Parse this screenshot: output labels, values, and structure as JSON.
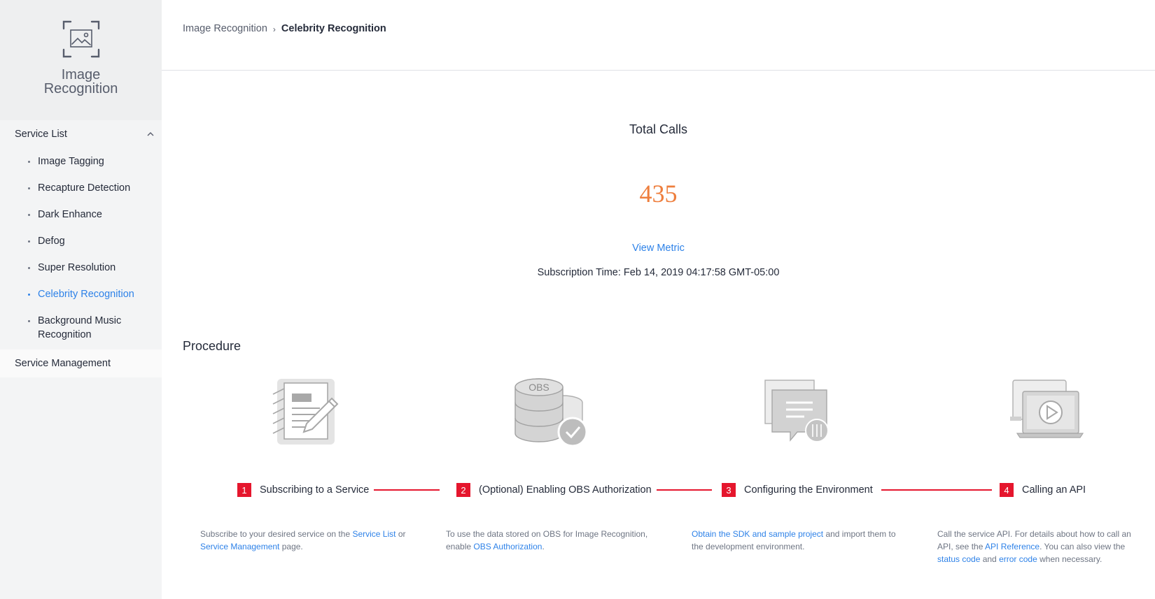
{
  "sidebar": {
    "brand_title": "Image Recognition",
    "group_label": "Service List",
    "items": [
      {
        "label": "Image Tagging"
      },
      {
        "label": "Recapture Detection"
      },
      {
        "label": "Dark Enhance"
      },
      {
        "label": "Defog"
      },
      {
        "label": "Super Resolution"
      },
      {
        "label": "Celebrity Recognition",
        "active": true
      },
      {
        "label": "Background Music Recognition"
      }
    ],
    "group2_label": "Service Management"
  },
  "breadcrumb": {
    "parent": "Image Recognition",
    "current": "Celebrity Recognition"
  },
  "stats": {
    "title": "Total Calls",
    "value": "435",
    "link": "View Metric",
    "subscription": "Subscription Time: Feb 14, 2019 04:17:58 GMT-05:00"
  },
  "procedure": {
    "title": "Procedure",
    "steps": [
      {
        "num": "1",
        "label": "Subscribing to a Service",
        "desc_1": "Subscribe to your desired service on the ",
        "link_1": "Service List",
        "desc_2": " or ",
        "link_2": "Service Management",
        "desc_3": " page."
      },
      {
        "num": "2",
        "label": "(Optional) Enabling OBS Authorization",
        "desc_1": "To use the data stored on OBS for Image Recognition, enable ",
        "link_1": "OBS Authorization",
        "desc_2": "."
      },
      {
        "num": "3",
        "label": "Configuring the Environment",
        "link_1": "Obtain the SDK and sample project",
        "desc_1": " and import them to the development environment."
      },
      {
        "num": "4",
        "label": "Calling an API",
        "desc_1": "Call the service API. For details about how to call an API, see the ",
        "link_1": "API Reference",
        "desc_2": ". You can also view the ",
        "link_2": "status code",
        "desc_3": " and ",
        "link_3": "error code",
        "desc_4": " when necessary."
      }
    ],
    "obs_icon_text": "OBS"
  },
  "colors": {
    "accent": "#2e82e8",
    "value": "#ee7e3d",
    "step": "#e5162d"
  }
}
